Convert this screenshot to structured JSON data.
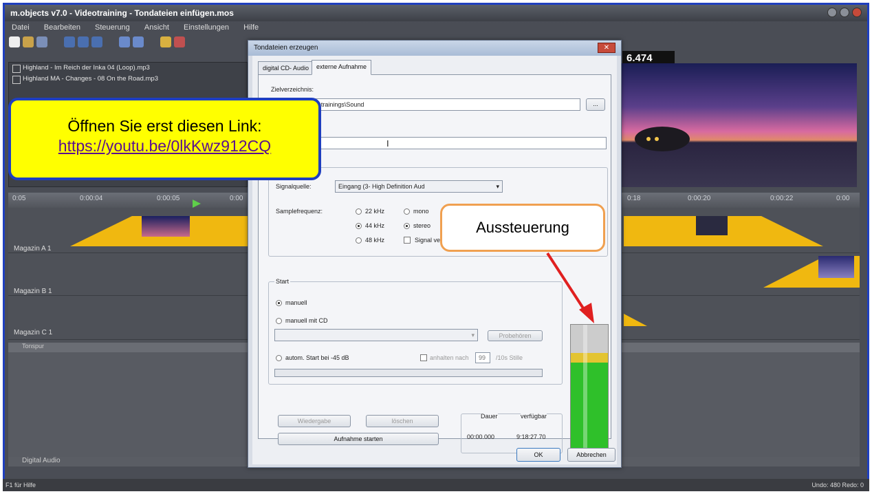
{
  "window": {
    "title": "m.objects v7.0 - Videotraining - Tondateien einfügen.mos"
  },
  "menu": [
    "Datei",
    "Bearbeiten",
    "Steuerung",
    "Ansicht",
    "Einstellungen",
    "Hilfe"
  ],
  "timecode": "6.474",
  "files": [
    "Highland - Im Reich der Inka 04 (Loop).mp3",
    "Highland MA - Changes - 08 On the Road.mp3"
  ],
  "ruler": [
    "0:05",
    "0:00:04",
    "0:00:05",
    "0:00",
    "0:18",
    "0:00:20",
    "0:00:22",
    "0:00"
  ],
  "tracks": {
    "a": "Magazin A 1",
    "b": "Magazin B 1",
    "c": "Magazin C 1"
  },
  "lower": {
    "label": "Tonspur",
    "digital_audio": "Digital Audio"
  },
  "status": {
    "left": "F1 für Hilfe",
    "right": "Undo: 480  Redo: 0"
  },
  "dialog": {
    "title": "Tondateien erzeugen",
    "close": "✕",
    "tabs": [
      "digital CD- Audio",
      "externe Aufnahme"
    ],
    "zielverzeichnis_label": "Zielverzeichnis:",
    "zielverzeichnis_value": "aten\\Show\\Videotrainings\\Sound",
    "browse": "...",
    "signalquelle_label": "Signalquelle:",
    "signalquelle_value": "Eingang (3- High Definition Aud",
    "samplefrequenz_label": "Samplefrequenz:",
    "freq": [
      "22 kHz",
      "44 kHz",
      "48 kHz"
    ],
    "channels": [
      "mono",
      "stereo"
    ],
    "signal_label": "Signal ve",
    "start_group": "Start",
    "start_options": [
      "manuell",
      "manuell mit CD"
    ],
    "probehoeren": "Probehören",
    "autom_start": "autom. Start bei -45 dB",
    "anhalten_label": "anhalten nach",
    "anhalten_value": "99",
    "stille_label": "/10s Stille",
    "wiedergabe": "Wiedergabe",
    "loeschen": "löschen",
    "aufnahme": "Aufnahme starten",
    "dauer_label": "Dauer",
    "dauer_value": "00:00.000",
    "verfuegbar_label": "verfügbar",
    "verfuegbar_value": "9:18:27.70",
    "ok": "OK",
    "abbrechen": "Abbrechen",
    "meter_level": 0.72
  },
  "callout_link": {
    "text": "Öffnen Sie erst diesen Link:",
    "url": "https://youtu.be/0lkKwz912CQ"
  },
  "callout_meter": {
    "text": "Aussteuerung"
  },
  "colors": {
    "frame": "#1f3fbf",
    "callout_bg": "#ffff00",
    "clip": "#f0b810",
    "meter_green": "#2fc02a",
    "arrow": "#e02020"
  }
}
